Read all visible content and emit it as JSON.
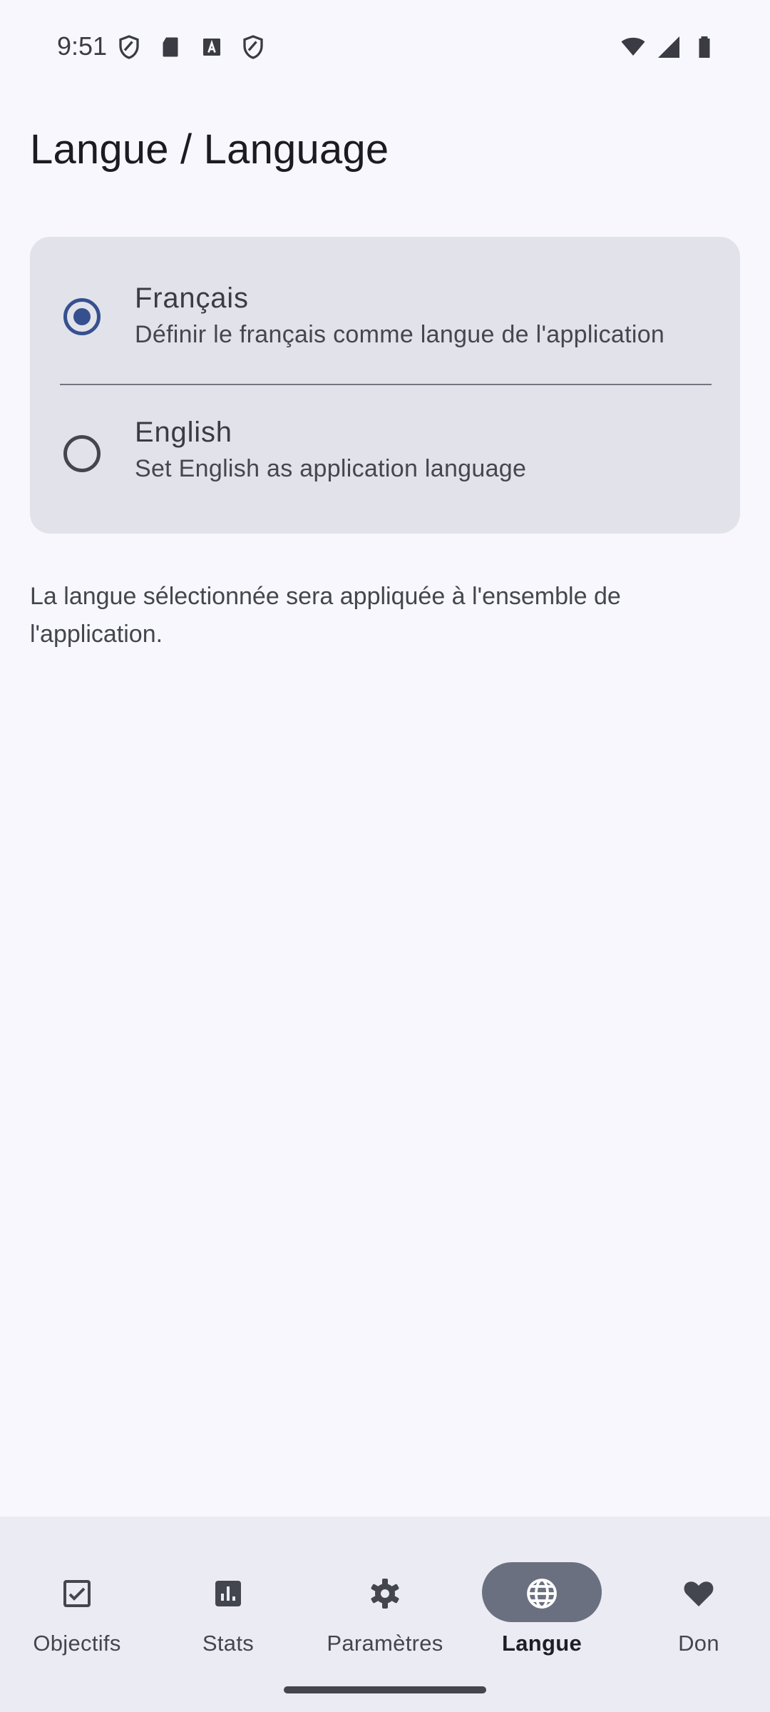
{
  "status_bar": {
    "time": "9:51",
    "icons_left": [
      "shield-icon",
      "sd-card-icon",
      "text-a-icon",
      "shield-icon"
    ],
    "icons_right": [
      "wifi-icon",
      "cell-signal-icon",
      "battery-icon"
    ]
  },
  "page": {
    "title": "Langue / Language"
  },
  "language_options": {
    "selected": "fr",
    "items": [
      {
        "id": "fr",
        "title": "Français",
        "subtitle": "Définir le français comme langue de l'application"
      },
      {
        "id": "en",
        "title": "English",
        "subtitle": "Set English as application language"
      }
    ]
  },
  "note": "La langue sélectionnée sera appliquée à l'ensemble de l'application.",
  "bottom_nav": {
    "active": "Langue",
    "items": [
      {
        "label": "Objectifs",
        "icon": "checkbox-icon"
      },
      {
        "label": "Stats",
        "icon": "bar-chart-icon"
      },
      {
        "label": "Paramètres",
        "icon": "gear-icon"
      },
      {
        "label": "Langue",
        "icon": "globe-icon"
      },
      {
        "label": "Don",
        "icon": "heart-icon"
      }
    ]
  },
  "colors": {
    "background": "#f7f7fd",
    "card": "#e2e2ea",
    "accent": "#36508f",
    "nav_background": "#ebebf3",
    "nav_active_pill": "#6b7080"
  }
}
